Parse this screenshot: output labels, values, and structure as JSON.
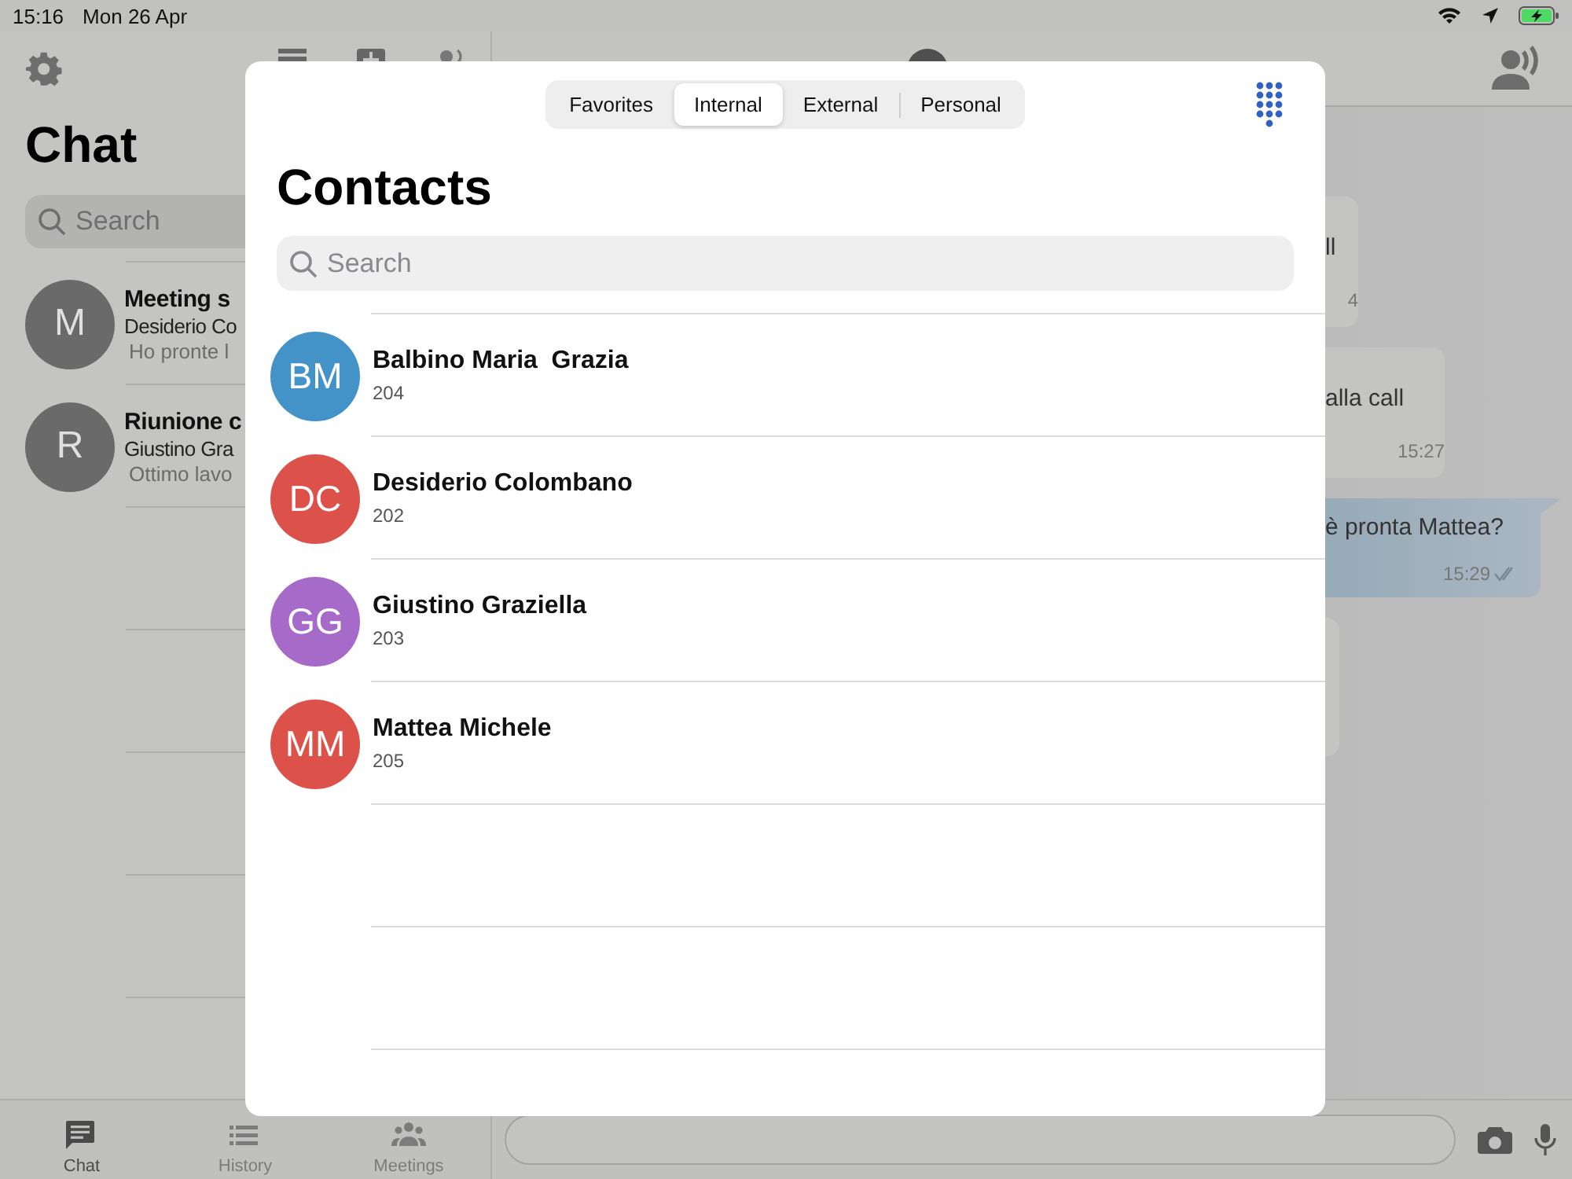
{
  "status_bar": {
    "time": "15:16",
    "date": "Mon 26 Apr"
  },
  "sidebar": {
    "title": "Chat",
    "search": {
      "placeholder": "Search"
    },
    "chats": [
      {
        "initial": "M",
        "title": "Meeting s",
        "sender": "Desiderio Co",
        "preview": "Ho pronte l"
      },
      {
        "initial": "R",
        "title": "Riunione c",
        "sender": "Giustino Gra",
        "preview": "Ottimo lavo"
      }
    ],
    "tab_bar": [
      {
        "kind": "chat",
        "label": "Chat",
        "selected": true
      },
      {
        "kind": "history",
        "label": "History",
        "selected": false
      },
      {
        "kind": "meetings",
        "label": "Meetings",
        "selected": false
      }
    ]
  },
  "conversation": {
    "messages": [
      {
        "kind": "incoming",
        "text": "ll",
        "time": "4"
      },
      {
        "kind": "incoming",
        "text": "alla call",
        "time": "15:27"
      },
      {
        "kind": "outgoing",
        "text": "è pronta Mattea?",
        "time": "15:29",
        "read": true
      },
      {
        "kind": "incoming"
      }
    ]
  },
  "modal": {
    "segments": [
      {
        "label": "Favorites",
        "selected": false
      },
      {
        "label": "Internal",
        "selected": true
      },
      {
        "label": "External",
        "selected": false
      },
      {
        "label": "Personal",
        "selected": false
      }
    ],
    "title": "Contacts",
    "search": {
      "placeholder": "Search"
    },
    "contacts": [
      {
        "initials": "BM",
        "name": "Balbino Maria  Grazia",
        "number": "204",
        "color": "#4393c9"
      },
      {
        "initials": "DC",
        "name": "Desiderio Colombano",
        "number": "202",
        "color": "#dc524a"
      },
      {
        "initials": "GG",
        "name": "Giustino Graziella",
        "number": "203",
        "color": "#a66bc9"
      },
      {
        "initials": "MM",
        "name": "Mattea Michele",
        "number": "205",
        "color": "#dc524a"
      }
    ]
  }
}
